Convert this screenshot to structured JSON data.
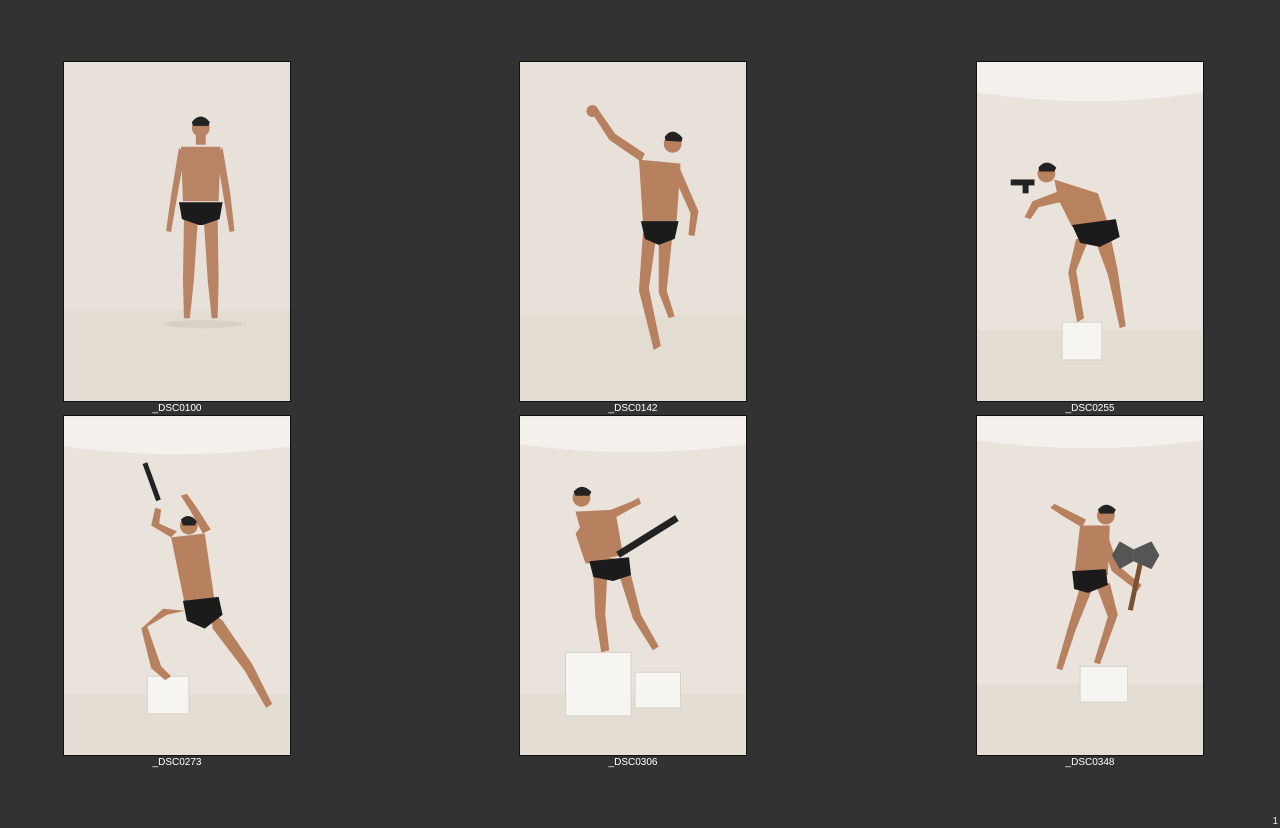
{
  "contact_sheet": {
    "background_color": "#323232",
    "page_number": "1",
    "photos": [
      {
        "caption": "_DSC0100",
        "prop": "none",
        "pose": "standing-front"
      },
      {
        "caption": "_DSC0142",
        "prop": "none",
        "pose": "raised-fist"
      },
      {
        "caption": "_DSC0255",
        "prop": "gun",
        "pose": "aiming-on-box"
      },
      {
        "caption": "_DSC0273",
        "prop": "gun",
        "pose": "lunge-gun-overhead"
      },
      {
        "caption": "_DSC0306",
        "prop": "shotgun",
        "pose": "on-boxes-shotgun"
      },
      {
        "caption": "_DSC0348",
        "prop": "axe",
        "pose": "axe-swing-on-box"
      }
    ]
  }
}
